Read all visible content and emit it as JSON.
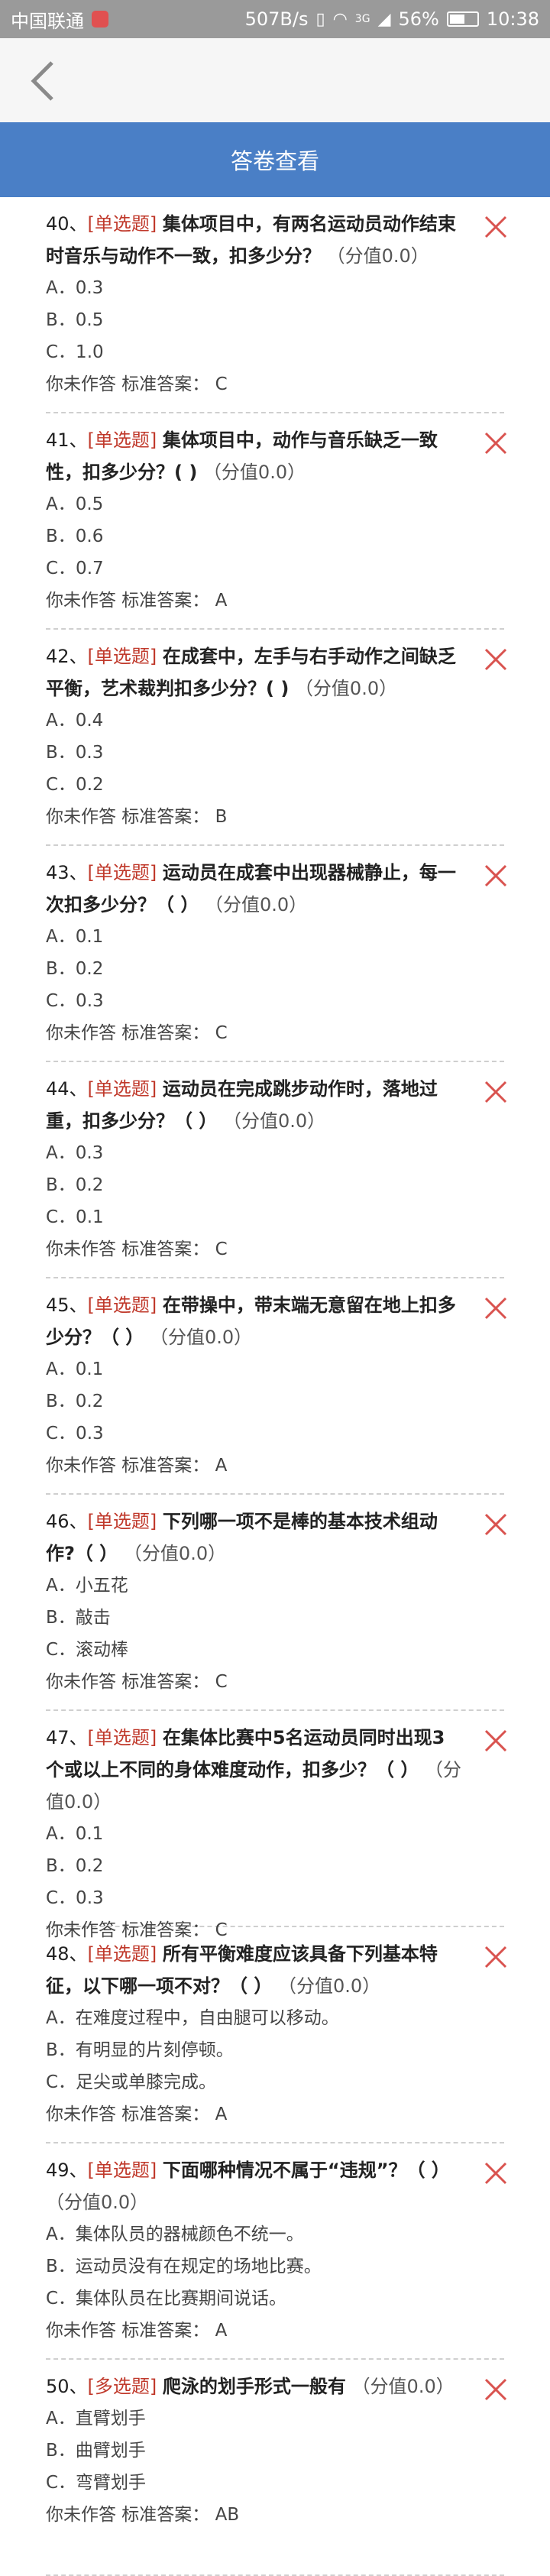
{
  "statusbar": {
    "carrier": "中国联通",
    "speed": "507B/s",
    "network": "3G",
    "battery": "56%",
    "time": "10:38"
  },
  "nav": {
    "back_icon": "chevron-left-icon"
  },
  "title": "答卷查看",
  "colors": {
    "header": "#4a7fc6",
    "type_label": "#c0392b",
    "wrong_mark": "#d9534f"
  },
  "questions": [
    {
      "num": "40、",
      "type": "[单选题]",
      "stem": "集体项目中，有两名运动员动作结束时音乐与动作不一致，扣多少分？",
      "score": "（分值0.0）",
      "options": [
        "A．0.3",
        "B．0.5",
        "C．1.0"
      ],
      "answer": "你未作答 标准答案： C"
    },
    {
      "num": "41、",
      "type": "[单选题]",
      "stem": "集体项目中，动作与音乐缺乏一致性，扣多少分？( )",
      "score": "（分值0.0）",
      "options": [
        "A．0.5",
        "B．0.6",
        "C．0.7"
      ],
      "answer": "你未作答 标准答案： A"
    },
    {
      "num": "42、",
      "type": "[单选题]",
      "stem": "在成套中，左手与右手动作之间缺乏平衡，艺术裁判扣多少分？( )",
      "score": "（分值0.0）",
      "options": [
        "A．0.4",
        "B．0.3",
        "C．0.2"
      ],
      "answer": "你未作答 标准答案： B"
    },
    {
      "num": "43、",
      "type": "[单选题]",
      "stem": "运动员在成套中出现器械静止，每一次扣多少分？（ ）",
      "score": "（分值0.0）",
      "options": [
        "A．0.1",
        "B．0.2",
        "C．0.3"
      ],
      "answer": "你未作答 标准答案： C"
    },
    {
      "num": "44、",
      "type": "[单选题]",
      "stem": "运动员在完成跳步动作时，落地过重，扣多少分？（ ）",
      "score": "（分值0.0）",
      "options": [
        "A．0.3",
        "B．0.2",
        "C．0.1"
      ],
      "answer": "你未作答 标准答案： C"
    },
    {
      "num": "45、",
      "type": "[单选题]",
      "stem": "在带操中，带末端无意留在地上扣多少分？（ ）",
      "score": "（分值0.0）",
      "options": [
        "A．0.1",
        "B．0.2",
        "C．0.3"
      ],
      "answer": "你未作答 标准答案： A"
    },
    {
      "num": "46、",
      "type": "[单选题]",
      "stem": "下列哪一项不是棒的基本技术组动作?（ ）",
      "score": "（分值0.0）",
      "options": [
        "A．小五花",
        "B．敲击",
        "C．滚动棒"
      ],
      "answer": "你未作答 标准答案： C"
    },
    {
      "num": "47、",
      "type": "[单选题]",
      "stem": "在集体比赛中5名运动员同时出现3个或以上不同的身体难度动作，扣多少？（ ）",
      "score": "（分值0.0）",
      "options": [
        "A．0.1",
        "B．0.2",
        "C．0.3"
      ],
      "answer": "你未作答 标准答案： C"
    },
    {
      "num": "48、",
      "type": "[单选题]",
      "stem": "所有平衡难度应该具备下列基本特征，以下哪一项不对？（ ）",
      "score": "（分值0.0）",
      "options": [
        "A．在难度过程中，自由腿可以移动。",
        "B．有明显的片刻停顿。",
        "C．足尖或单膝完成。"
      ],
      "answer": "你未作答 标准答案： A"
    },
    {
      "num": "49、",
      "type": "[单选题]",
      "stem": "下面哪种情况不属于“违规”？（ ）",
      "score": "（分值0.0）",
      "options": [
        "A．集体队员的器械颜色不统一。",
        "B．运动员没有在规定的场地比赛。",
        "C．集体队员在比赛期间说话。"
      ],
      "answer": "你未作答 标准答案： A"
    },
    {
      "num": "50、",
      "type": "[多选题]",
      "stem": "爬泳的划手形式一般有",
      "score": "（分值0.0）",
      "options": [
        "A．直臂划手",
        "B．曲臂划手",
        "C．弯臂划手"
      ],
      "answer": "你未作答 标准答案： AB"
    }
  ]
}
